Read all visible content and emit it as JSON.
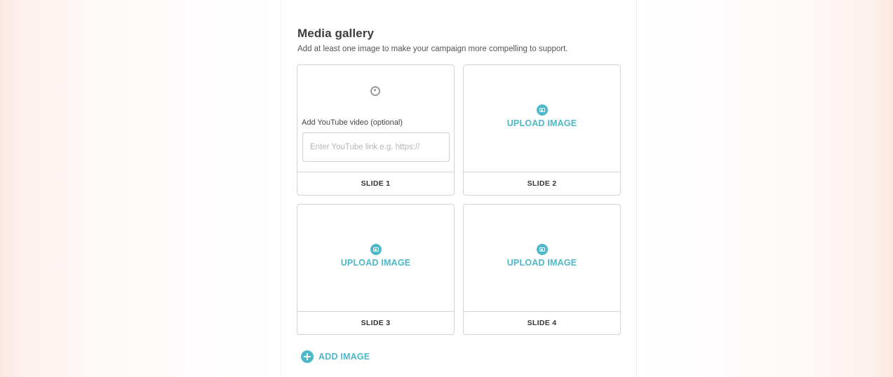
{
  "gallery": {
    "title": "Media gallery",
    "subtitle": "Add at least one image to make your campaign more compelling to support."
  },
  "slides": [
    {
      "footer": "SLIDE 1",
      "video_label": "Add YouTube video (optional)",
      "video_placeholder": "Enter YouTube link e.g. https://",
      "video_value": "",
      "icon": "video-icon"
    },
    {
      "footer": "SLIDE 2",
      "upload_label": "UPLOAD IMAGE",
      "icon": "camera-icon"
    },
    {
      "footer": "SLIDE 3",
      "upload_label": "UPLOAD IMAGE",
      "icon": "camera-icon"
    },
    {
      "footer": "SLIDE 4",
      "upload_label": "UPLOAD IMAGE",
      "icon": "camera-icon"
    }
  ],
  "add_image": {
    "label": "ADD IMAGE",
    "icon": "plus-circle-icon"
  },
  "colors": {
    "accent": "#4db8c9",
    "border": "#d4d4d4",
    "background_tint": "#fbe7e0"
  }
}
